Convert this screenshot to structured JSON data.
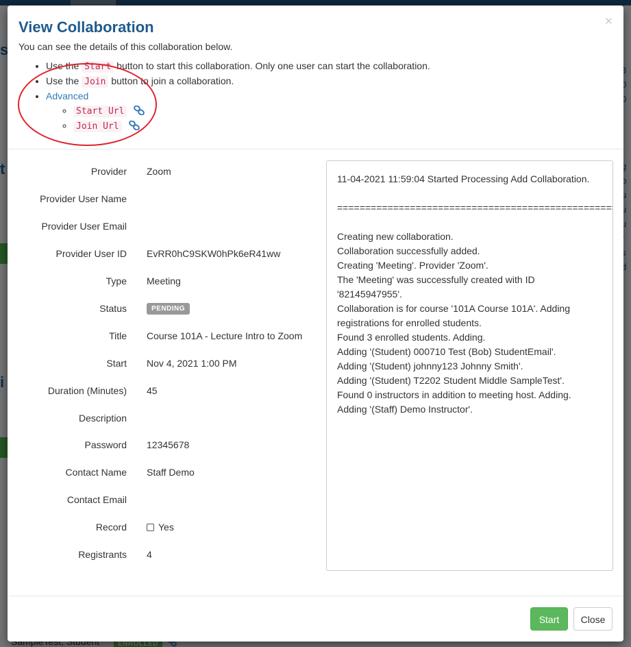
{
  "modal": {
    "title": "View Collaboration",
    "close_glyph": "×",
    "subtitle": "You can see the details of this collaboration below.",
    "help": {
      "line1_pre": "Use the ",
      "line1_code": "Start",
      "line1_post": " button to start this collaboration. Only one user can start the collaboration.",
      "line2_pre": "Use the ",
      "line2_code": "Join",
      "line2_post": " button to join a collaboration.",
      "advanced_label": "Advanced",
      "start_url_label": "Start Url",
      "join_url_label": "Join Url",
      "link_icon": "chain-link-icon"
    },
    "annotation_color": "#e0232b"
  },
  "details": [
    {
      "label": "Provider",
      "value": "Zoom"
    },
    {
      "label": "Provider User Name",
      "value": ""
    },
    {
      "label": "Provider User Email",
      "value": ""
    },
    {
      "label": "Provider User ID",
      "value": "EvRR0hC9SKW0hPk6eR41ww"
    },
    {
      "label": "Type",
      "value": "Meeting"
    },
    {
      "label": "Status",
      "value": "PENDING"
    },
    {
      "label": "Title",
      "value": "Course 101A - Lecture Intro to Zoom"
    },
    {
      "label": "Start",
      "value": "Nov 4, 2021 1:00 PM"
    },
    {
      "label": "Duration (Minutes)",
      "value": "45"
    },
    {
      "label": "Description",
      "value": ""
    },
    {
      "label": "Password",
      "value": "12345678"
    },
    {
      "label": "Contact Name",
      "value": "Staff Demo"
    },
    {
      "label": "Contact Email",
      "value": ""
    },
    {
      "label": "Record",
      "value": "Yes",
      "checked": false
    },
    {
      "label": "Registrants",
      "value": "4"
    }
  ],
  "log": {
    "header": "11-04-2021 11:59:04 Started Processing Add Collaboration.",
    "separator": "========================================================",
    "lines": [
      "Creating new collaboration.",
      "Collaboration successfully added.",
      "Creating 'Meeting'. Provider 'Zoom'.",
      "The 'Meeting' was successfully created with ID '82145947955'.",
      "Collaboration is for course '101A Course 101A'. Adding registrations for enrolled students.",
      "Found 3 enrolled students. Adding.",
      "Adding '(Student) 000710 Test (Bob) StudentEmail'.",
      "Adding '(Student) johnny123 Johnny Smith'.",
      "Adding '(Student) T2202 Student Middle SampleTest'.",
      "Found 0 instructors in addition to meeting host. Adding.",
      "Adding '(Staff) Demo Instructor'."
    ]
  },
  "footer": {
    "start_label": "Start",
    "close_label": "Close"
  },
  "background": {
    "bottom_row_name": "SampleTest, Student",
    "bottom_row_badge": "ENROLLED"
  },
  "colors": {
    "title": "#1f5b8d",
    "link": "#337ab7",
    "start_button": "#5cb85c",
    "pending_badge": "#999999",
    "code_text": "#c7254e"
  }
}
